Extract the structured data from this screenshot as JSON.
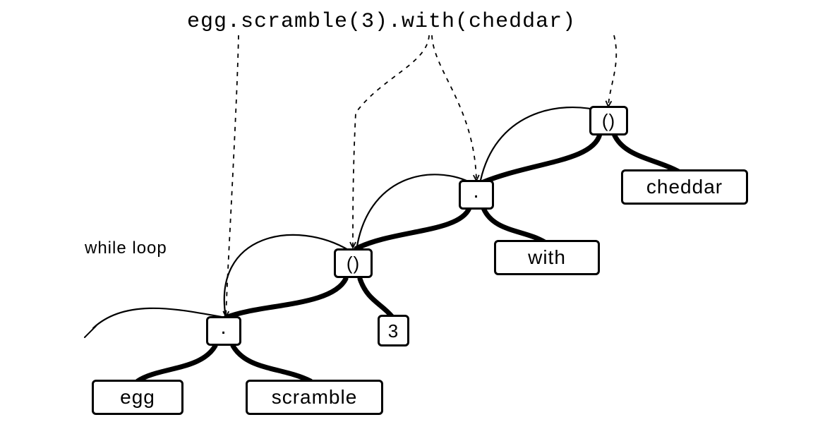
{
  "title": "egg.scramble(3).with(cheddar)",
  "annotation": "while loop",
  "nodes": {
    "call2": {
      "label": "()"
    },
    "dot2": {
      "label": "."
    },
    "cheddar": {
      "label": "cheddar"
    },
    "call1": {
      "label": "()"
    },
    "with": {
      "label": "with"
    },
    "dot1": {
      "label": "."
    },
    "three": {
      "label": "3"
    },
    "egg": {
      "label": "egg"
    },
    "scramble": {
      "label": "scramble"
    }
  },
  "colors": {
    "ink": "#000000",
    "paper": "#ffffff"
  }
}
